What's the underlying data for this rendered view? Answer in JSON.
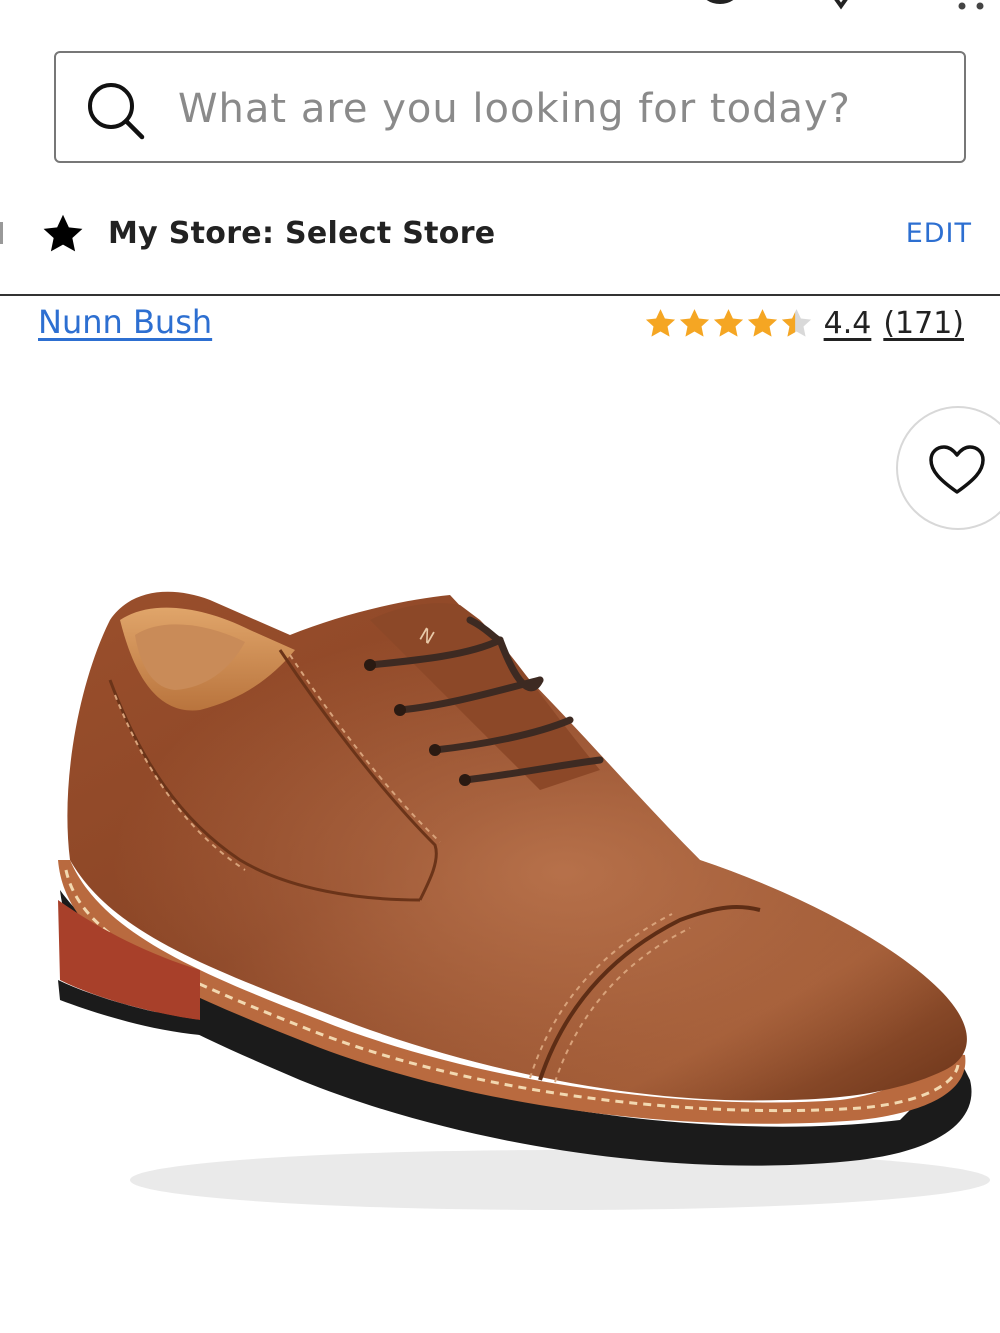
{
  "header": {
    "icons": [
      "account-icon",
      "location-icon",
      "more-icon"
    ]
  },
  "search": {
    "placeholder": "What are you looking for today?",
    "value": ""
  },
  "store": {
    "label": "My Store: Select Store",
    "edit_label": "EDIT"
  },
  "product": {
    "brand": "Nunn Bush",
    "rating": {
      "value": "4.4",
      "count": "(171)",
      "stars_filled": 4.4,
      "stars_max": 5
    }
  },
  "colors": {
    "accent": "#2d6fd1",
    "star": "#f5a623",
    "text": "#222222"
  }
}
